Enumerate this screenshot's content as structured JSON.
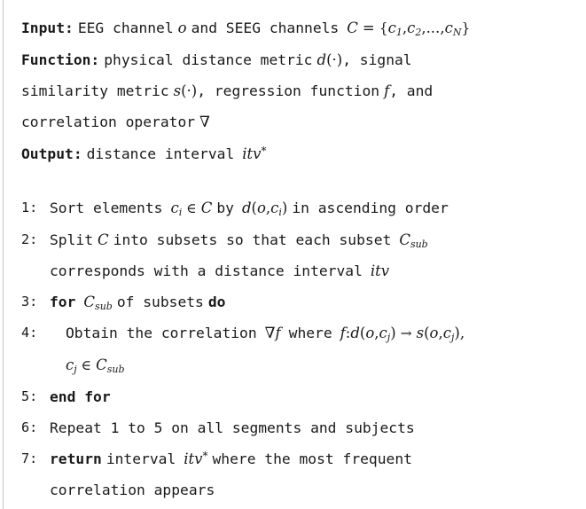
{
  "algorithm": {
    "header": [
      {
        "id": "input",
        "keyword": "Input:",
        "text_before": "EEG channel",
        "var_o": "o",
        "text_mid": "and SEEG channels",
        "set_name": "C",
        "equals": "=",
        "brace_open": "{",
        "elem1": "c",
        "elem1_sub": "1",
        "comma1": ",",
        "elem2": "c",
        "elem2_sub": "2",
        "comma2": ",",
        "ellipsis": "...",
        "comma3": ",",
        "elemN": "c",
        "elemN_sub": "N",
        "brace_close": "}",
        "plain": "Input: EEG channel o and SEEG channels C = {c1, c2, ..., cN}"
      },
      {
        "id": "function",
        "keyword": "Function:",
        "text1": "physical distance metric",
        "d_var": "d",
        "d_arg": "(·)",
        "text2": ", signal",
        "plain": "Function: physical distance metric d(·), signal"
      },
      {
        "id": "function-cont-1",
        "text1": "similarity metric",
        "s_var": "s",
        "s_arg": "(·)",
        "text2": ", regression function",
        "f_var": "f",
        "text3": ", and",
        "plain": "similarity metric s(·), regression function f, and"
      },
      {
        "id": "function-cont-2",
        "text1": "correlation operator",
        "nabla": "∇",
        "plain": "correlation operator ∇"
      },
      {
        "id": "output",
        "keyword": "Output:",
        "text1": "distance interval",
        "itv": "itv",
        "itv_star": "*",
        "plain": "Output: distance interval itv*"
      }
    ],
    "steps": [
      {
        "number": "1:",
        "plain": "Sort elements c_i ∈ C by d(o, c_i) in ascending order",
        "parts": {
          "t1": "Sort elements",
          "c": "c",
          "c_sub": "i",
          "in": "∈",
          "C": "C",
          "t2": "by",
          "d": "d",
          "d_open": "(",
          "o": "o",
          "d_comma": ",",
          "c2": "c",
          "c2_sub": "i",
          "d_close": ")",
          "t3": "in ascending order"
        }
      },
      {
        "number": "2:",
        "plain": "Split C into subsets so that each subset C_sub",
        "parts": {
          "t1": "Split",
          "C": "C",
          "t2": "into subsets so that each subset",
          "Csub": "C",
          "Csub_sub": "sub"
        },
        "continuation": {
          "plain": "corresponds with a distance interval itv",
          "t1": "corresponds with a distance interval",
          "itv": "itv"
        }
      },
      {
        "number": "3:",
        "plain": "for C_sub of subsets do",
        "parts": {
          "kw1": "for",
          "Csub": "C",
          "Csub_sub": "sub",
          "t1": "of subsets",
          "kw2": "do"
        }
      },
      {
        "number": "4:",
        "plain": "Obtain the correlation ∇f where f : d(o, c_j) → s(o, c_j),",
        "parts": {
          "t1": "Obtain the correlation",
          "nabla": "∇",
          "f": "f",
          "t2": "where",
          "f2": "f",
          "colon": ":",
          "d": "d",
          "d_open": "(",
          "o": "o",
          "d_comma": ",",
          "cj": "c",
          "cj_sub": "j",
          "d_close": ")",
          "arrow": "→",
          "s": "s",
          "s_open": "(",
          "o2": "o",
          "s_comma": ",",
          "cj2": "c",
          "cj2_sub": "j",
          "s_close": ")",
          "trailing_comma": ","
        },
        "continuation": {
          "plain": "c_j ∈ C_sub",
          "cj": "c",
          "cj_sub": "j",
          "in": "∈",
          "Csub": "C",
          "Csub_sub": "sub"
        }
      },
      {
        "number": "5:",
        "plain": "end for",
        "parts": {
          "kw1": "end for"
        }
      },
      {
        "number": "6:",
        "plain": "Repeat 1 to 5 on all segments and subjects",
        "parts": {
          "t1": "Repeat 1 to 5 on all segments and subjects"
        }
      },
      {
        "number": "7:",
        "plain": "return interval itv* where the most frequent",
        "parts": {
          "kw1": "return",
          "t1": "interval",
          "itv": "itv",
          "itv_star": "*",
          "t2": "where the most frequent"
        },
        "continuation": {
          "plain": "correlation appears",
          "t1": "correlation appears"
        }
      }
    ]
  },
  "colors": {
    "text": "#1a1a1a",
    "rule": "#c4c4c4",
    "background": "#ffffff"
  }
}
